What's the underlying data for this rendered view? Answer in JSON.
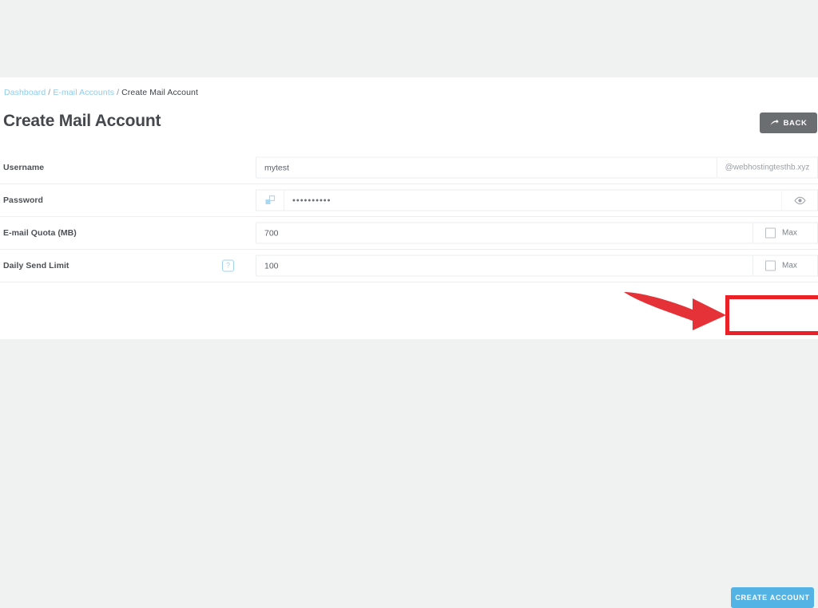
{
  "breadcrumb": {
    "items": [
      {
        "label": "Dashboard",
        "link": true
      },
      {
        "label": "E-mail Accounts",
        "link": true
      },
      {
        "label": "Create Mail Account",
        "link": false
      }
    ],
    "separator": "/"
  },
  "header": {
    "title": "Create Mail Account",
    "back_label": "BACK",
    "back_icon": "curved-arrow-right-icon"
  },
  "form": {
    "username": {
      "label": "Username",
      "value": "mytest",
      "placeholder": "",
      "domain_suffix": "@webhostingtesthb.xyz"
    },
    "password": {
      "label": "Password",
      "value": "••••••••••",
      "placeholder": "",
      "generate_icon": "generate-password-icon",
      "reveal_icon": "eye-icon"
    },
    "quota": {
      "label": "E-mail Quota (MB)",
      "value": "700",
      "placeholder": "",
      "max_label": "Max",
      "max_checked": false
    },
    "daily_limit": {
      "label": "Daily Send Limit",
      "value": "100",
      "placeholder": "",
      "max_label": "Max",
      "max_checked": false,
      "help_icon": "?"
    }
  },
  "actions": {
    "create_label": "CREATE ACCOUNT"
  },
  "annotation": {
    "highlight_color": "#ec2127",
    "arrow_color": "#e53138",
    "target": "create-account-button"
  },
  "colors": {
    "accent_blue": "#52b3e4",
    "link_blue": "#8ecdf0",
    "back_gray": "#6b6e70",
    "page_bg": "#f0f2f2",
    "sheet_bg": "#ffffff",
    "text_dark": "#44484d"
  }
}
